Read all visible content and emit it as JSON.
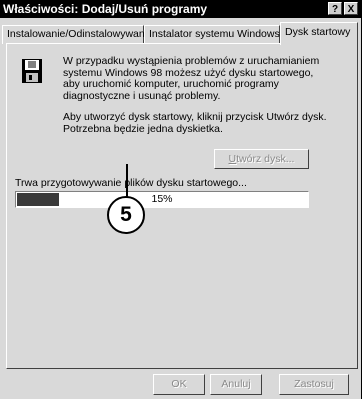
{
  "window": {
    "title": "Właściwości: Dodaj/Usuń programy",
    "help_label": "?",
    "close_label": "X"
  },
  "tabs": [
    {
      "label": "Instalowanie/Odinstalowywanie",
      "active": false
    },
    {
      "label": "Instalator systemu Windows",
      "active": false
    },
    {
      "label": "Dysk startowy",
      "active": true
    }
  ],
  "content": {
    "icon": "floppy-disk-icon",
    "paragraph1": "W przypadku wystąpienia problemów z uruchamianiem\nsystemu Windows 98 możesz użyć dysku startowego,\naby uruchomić komputer, uruchomić programy\ndiagnostyczne i usunąć problemy.",
    "paragraph2": "Aby utworzyć dysk startowy, kliknij przycisk Utwórz dysk.\nPotrzebna będzie jedna dyskietka.",
    "create_disk_button": {
      "prefix": "U",
      "rest": "twórz dysk...",
      "enabled": false
    },
    "status_text": "Trwa przygotowywanie plików dysku startowego...",
    "progress": {
      "value": 15,
      "label": "15%"
    }
  },
  "callout": {
    "number": "5"
  },
  "footer": {
    "ok_label": "OK",
    "cancel_label": "Anuluj",
    "apply_label": "Zastosuj"
  },
  "colors": {
    "titlebar": "#000000",
    "dialog_bg": "#d9d9d9",
    "progress_fill": "#3a3a3a",
    "disabled_text": "#8a8a8a"
  }
}
